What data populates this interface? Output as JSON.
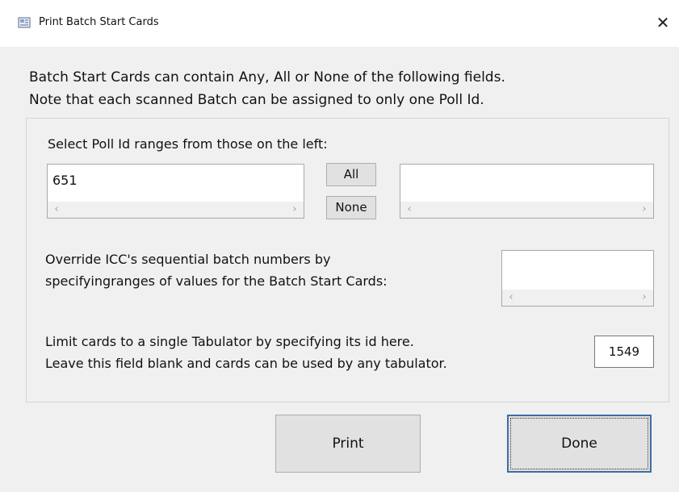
{
  "window": {
    "title": "Print Batch Start Cards",
    "close_glyph": "✕",
    "icon": "window-app-icon"
  },
  "intro": {
    "line1": "Batch Start Cards can contain Any, All or None of the following fields.",
    "line2": "Note that each scanned Batch can be assigned to only one Poll Id."
  },
  "poll": {
    "label": "Select Poll Id ranges from those on the left:",
    "available": [
      "651"
    ],
    "selected": [],
    "all_button": "All",
    "none_button": "None"
  },
  "override": {
    "line1": "Override ICC's sequential batch numbers by",
    "line2": "specifyingranges of values for the Batch Start Cards:",
    "values": []
  },
  "tabulator": {
    "line1": "Limit cards to a single Tabulator by specifying its id here.",
    "line2": "Leave this field blank and cards can be used by any tabulator.",
    "value": "1549"
  },
  "buttons": {
    "print": "Print",
    "done": "Done"
  },
  "scroll_arrows": {
    "left": "‹",
    "right": "›"
  }
}
